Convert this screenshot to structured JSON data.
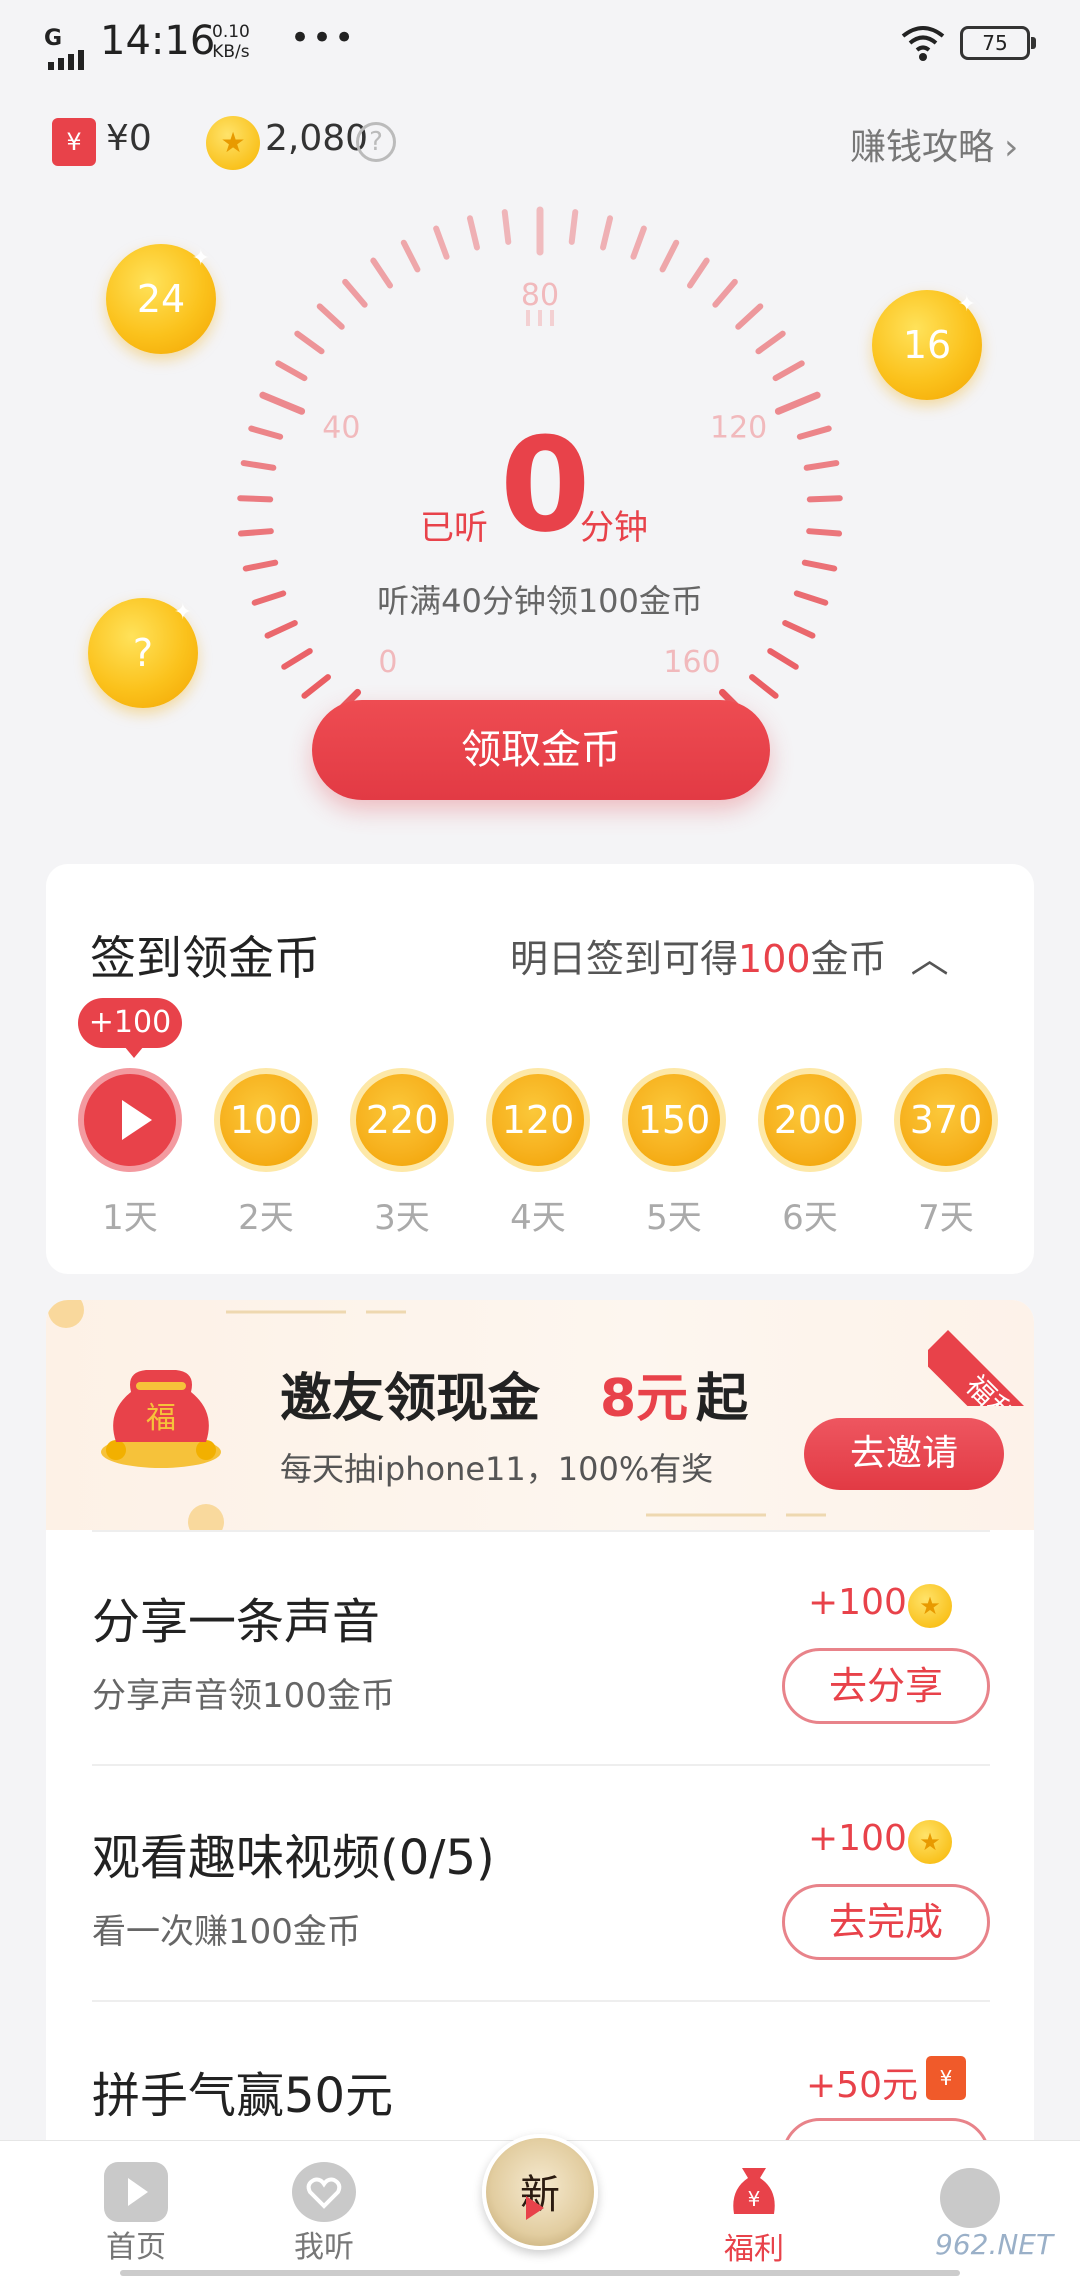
{
  "status_bar": {
    "network": "G",
    "time": "14:16",
    "speed_value": "0.10",
    "speed_unit": "KB/s",
    "more": "•••",
    "battery": "75"
  },
  "wallet": {
    "money_icon": "¥",
    "money": "¥0",
    "coins": "2,080",
    "help": "?",
    "earn_guide": "赚钱攻略",
    "chevron": "›"
  },
  "floating_coins": [
    {
      "label": "24"
    },
    {
      "label": "16"
    },
    {
      "label": "?"
    }
  ],
  "gauge": {
    "ticks": [
      "0",
      "40",
      "80",
      "120",
      "160"
    ],
    "listened_prefix": "已听",
    "listened_minutes": "0",
    "listened_unit": "分钟",
    "hint": "听满40分钟领100金币",
    "progress_fraction": 0,
    "max_minutes": 160
  },
  "claim_button": "领取金币",
  "checkin": {
    "title": "签到领金币",
    "tip_prefix": "明日签到可得",
    "tip_amount": "100",
    "tip_suffix": "金币",
    "collapse_icon": "chevron-up-icon",
    "today_badge": "+100",
    "days": [
      {
        "label": "1天",
        "value": "",
        "active": true
      },
      {
        "label": "2天",
        "value": "100"
      },
      {
        "label": "3天",
        "value": "220"
      },
      {
        "label": "4天",
        "value": "120"
      },
      {
        "label": "5天",
        "value": "150"
      },
      {
        "label": "6天",
        "value": "200"
      },
      {
        "label": "7天",
        "value": "370"
      }
    ]
  },
  "invite": {
    "ribbon": "福利",
    "bag_char": "福",
    "title": "邀友领现金",
    "amount": "8元",
    "amount_suffix": "起",
    "subtitle": "每天抽iphone11，100%有奖",
    "button": "去邀请"
  },
  "tasks": [
    {
      "title": "分享一条声音",
      "sub": "分享声音领100金币",
      "reward": "+100",
      "reward_icon": "coin",
      "button": "去分享"
    },
    {
      "title": "观看趣味视频(0/5)",
      "sub": "看一次赚100金币",
      "reward": "+100",
      "reward_icon": "coin",
      "button": "去完成"
    },
    {
      "title": "拼手气赢50元",
      "sub": "",
      "reward": "+50元",
      "reward_icon": "red-packet",
      "button": ""
    }
  ],
  "tabbar": {
    "items": [
      {
        "label": "首页",
        "icon": "home-play-icon"
      },
      {
        "label": "我听",
        "icon": "heart-icon"
      },
      {
        "label": "",
        "icon": "now-playing-disc-icon"
      },
      {
        "label": "福利",
        "icon": "money-bag-icon",
        "active": true
      },
      {
        "label": "",
        "icon": "profile-icon"
      }
    ],
    "center_disc_text": "新"
  },
  "watermark": "962.NET",
  "colors": {
    "accent": "#e8424a",
    "coin": "#f7b21f",
    "background": "#f4f4f6"
  }
}
